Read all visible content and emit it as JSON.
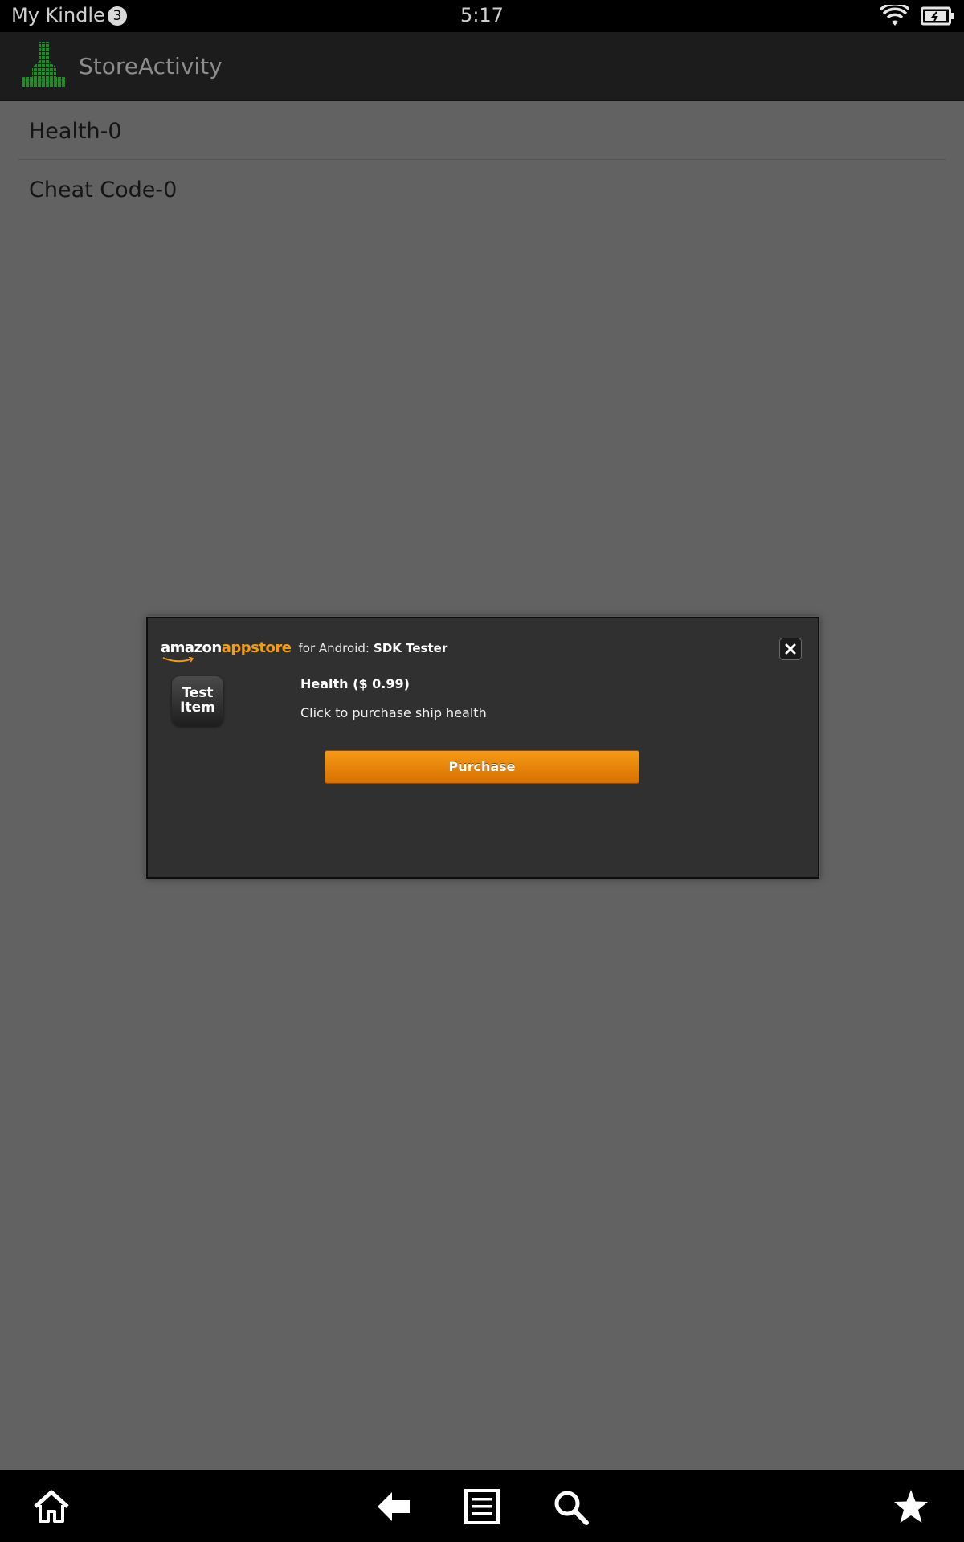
{
  "status_bar": {
    "title": "My Kindle",
    "notification_count": "3",
    "time": "5:17",
    "wifi_icon": "wifi-icon",
    "battery_icon": "battery-icon"
  },
  "action_bar": {
    "icon": "app-icon",
    "title": "StoreActivity"
  },
  "list": {
    "items": [
      {
        "label": "Health-0"
      },
      {
        "label": "Cheat Code-0"
      }
    ]
  },
  "dialog": {
    "brand_amazon": "amazon",
    "brand_appstore": "appstore",
    "brand_for": "for Android:",
    "brand_app": "SDK Tester",
    "close_icon": "close-icon",
    "test_item_line1": "Test",
    "test_item_line2": "Item",
    "item_title": "Health ($ 0.99)",
    "item_description": "Click to purchase ship health",
    "purchase_label": "Purchase"
  },
  "nav_bar": {
    "items": [
      "home-icon",
      "back-icon",
      "menu-icon",
      "search-icon",
      "favorites-icon"
    ]
  },
  "colors": {
    "background": "#626262",
    "accent_orange": "#f39c12",
    "dialog_bg": "#303030"
  }
}
